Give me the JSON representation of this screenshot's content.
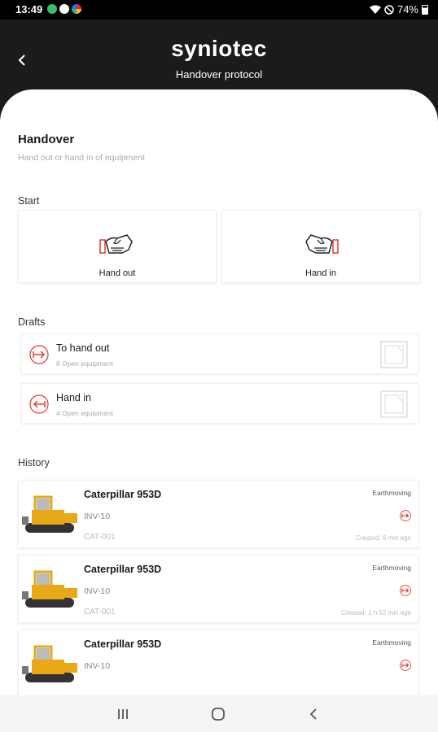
{
  "status": {
    "time": "13:49",
    "battery": "74%"
  },
  "header": {
    "brand": "syniotec",
    "subtitle": "Handover protocol"
  },
  "page": {
    "title": "Handover",
    "description": "Hand out or hand in of equipment"
  },
  "start": {
    "label": "Start",
    "options": [
      {
        "label": "Hand out"
      },
      {
        "label": "Hand in"
      }
    ]
  },
  "drafts": {
    "label": "Drafts",
    "items": [
      {
        "name": "To hand out",
        "count": "8 Open equipment"
      },
      {
        "name": "Hand in",
        "count": "4 Open equipment"
      }
    ]
  },
  "history": {
    "label": "History",
    "items": [
      {
        "name": "Caterpillar 953D",
        "inventory": "INV-10",
        "serial": "CAT-001",
        "category": "Earthmoving",
        "created": "Created: 6 min ago"
      },
      {
        "name": "Caterpillar 953D",
        "inventory": "INV-10",
        "serial": "CAT-001",
        "category": "Earthmoving",
        "created": "Created: 1 h 52 min ago"
      },
      {
        "name": "Caterpillar 953D",
        "inventory": "INV-10",
        "serial": "",
        "category": "Earthmoving",
        "created": ""
      }
    ]
  },
  "colors": {
    "accent": "#e23b2e",
    "header_bg": "#1b1b1b",
    "machine_yellow": "#e8a818"
  },
  "icons": [
    "back-arrow-icon",
    "handshake-out-icon",
    "handshake-in-icon",
    "hand-out-arrow-icon",
    "hand-in-arrow-icon",
    "document-icon",
    "recents-icon",
    "home-icon",
    "back-icon"
  ]
}
